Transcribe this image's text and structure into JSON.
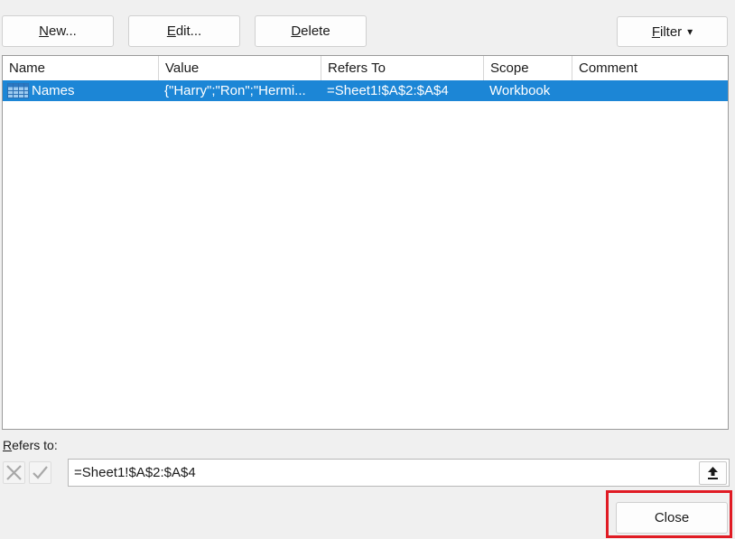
{
  "toolbar": {
    "new": {
      "u": "N",
      "rest": "ew..."
    },
    "edit": {
      "u": "E",
      "rest": "dit..."
    },
    "delete": {
      "u": "D",
      "rest": "elete"
    },
    "filter": {
      "u": "F",
      "rest": "ilter",
      "arrow": "▾"
    }
  },
  "table": {
    "columns": [
      "Name",
      "Value",
      "Refers To",
      "Scope",
      "Comment"
    ],
    "rows": [
      {
        "icon": "range-grid-icon",
        "name": "Names",
        "value": "{\"Harry\";\"Ron\";\"Hermi...",
        "refers_to": "=Sheet1!$A$2:$A$4",
        "scope": "Workbook",
        "comment": "",
        "selected": true
      }
    ]
  },
  "refers_label": {
    "u": "R",
    "rest": "efers to:"
  },
  "refers_value": "=Sheet1!$A$2:$A$4",
  "close_label": "Close",
  "colors": {
    "selection": "#1c86d6",
    "highlight": "#e01b24"
  }
}
